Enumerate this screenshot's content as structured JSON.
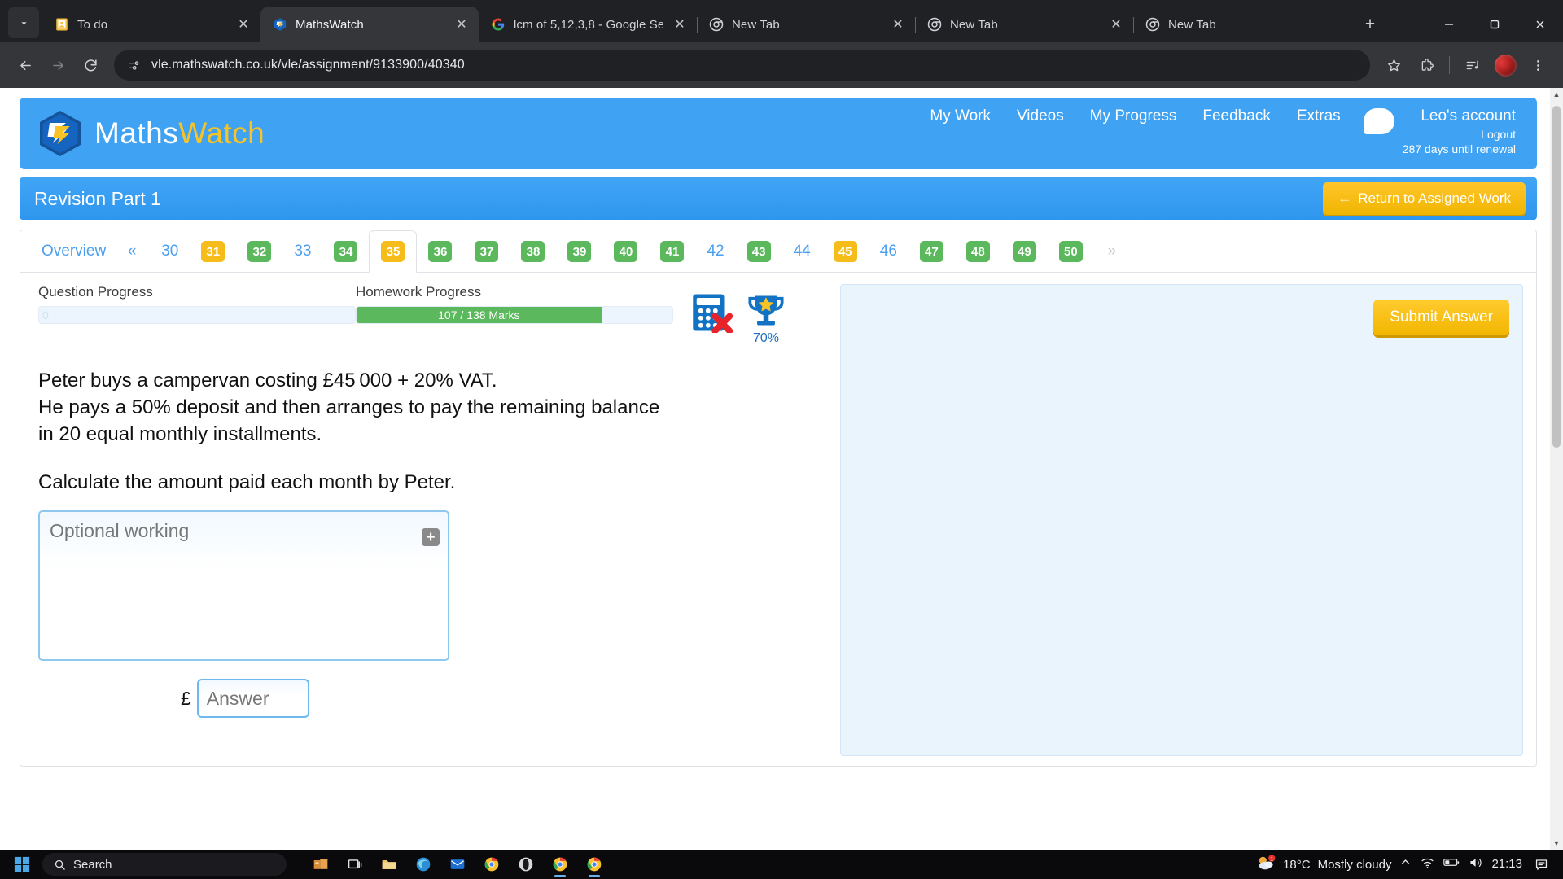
{
  "browser": {
    "tabs": [
      {
        "title": "To do",
        "favicon": "todo-icon",
        "active": false
      },
      {
        "title": "MathsWatch",
        "favicon": "mathswatch-icon",
        "active": true
      },
      {
        "title": "lcm of 5,12,3,8 - Google Se",
        "favicon": "google-icon",
        "active": false
      },
      {
        "title": "New Tab",
        "favicon": "chrome-icon",
        "active": false
      },
      {
        "title": "New Tab",
        "favicon": "chrome-icon",
        "active": false
      },
      {
        "title": "New Tab",
        "favicon": "chrome-icon",
        "active": false
      }
    ],
    "new_tab_label": "+",
    "close_label": "✕",
    "url": "vle.mathswatch.co.uk/vle/assignment/9133900/40340",
    "toolbar_icons": [
      "bookmark-star-icon",
      "extensions-icon",
      "media-playlist-icon",
      "profile-avatar",
      "chrome-menu-icon"
    ]
  },
  "site": {
    "logo": {
      "maths": "Maths",
      "watch": "Watch"
    },
    "nav": [
      "My Work",
      "Videos",
      "My Progress",
      "Feedback",
      "Extras"
    ],
    "account": {
      "name": "Leo's account",
      "logout": "Logout",
      "renewal": "287 days until renewal"
    },
    "assignment_title": "Revision Part 1",
    "return_button": "Return to Assigned Work",
    "return_arrow": "←"
  },
  "question_tabs": {
    "overview_label": "Overview",
    "prev_label": "«",
    "next_label": "»",
    "items": [
      {
        "num": "30",
        "state": "plain"
      },
      {
        "num": "31",
        "state": "amber"
      },
      {
        "num": "32",
        "state": "green"
      },
      {
        "num": "33",
        "state": "plain"
      },
      {
        "num": "34",
        "state": "green"
      },
      {
        "num": "35",
        "state": "amber",
        "active": true
      },
      {
        "num": "36",
        "state": "green"
      },
      {
        "num": "37",
        "state": "green"
      },
      {
        "num": "38",
        "state": "green"
      },
      {
        "num": "39",
        "state": "green"
      },
      {
        "num": "40",
        "state": "green"
      },
      {
        "num": "41",
        "state": "green"
      },
      {
        "num": "42",
        "state": "plain"
      },
      {
        "num": "43",
        "state": "green"
      },
      {
        "num": "44",
        "state": "plain"
      },
      {
        "num": "45",
        "state": "amber"
      },
      {
        "num": "46",
        "state": "plain"
      },
      {
        "num": "47",
        "state": "green"
      },
      {
        "num": "48",
        "state": "green"
      },
      {
        "num": "49",
        "state": "green"
      },
      {
        "num": "50",
        "state": "green"
      }
    ]
  },
  "progress": {
    "question": {
      "label": "Question Progress",
      "value_text": "0",
      "percent": 0
    },
    "homework": {
      "label": "Homework Progress",
      "value_text": "107 / 138 Marks",
      "percent": 77.5
    },
    "calculator": {
      "name": "calculator-not-allowed-icon"
    },
    "trophy": {
      "name": "trophy-icon",
      "percent_label": "70%"
    }
  },
  "question": {
    "line1": "Peter buys a campervan costing £45 000 + 20% VAT.",
    "line2": "He pays a 50% deposit and then arranges to pay the remaining balance",
    "line3": "in 20 equal monthly installments.",
    "line4": "Calculate the amount paid each month by Peter.",
    "working_placeholder": "Optional working",
    "working_value": "",
    "expand_label": "+",
    "answer_prefix": "£",
    "answer_placeholder": "Answer",
    "answer_value": "",
    "submit_label": "Submit Answer"
  },
  "colors": {
    "brand_blue": "#3fa2f2",
    "amber": "#f5bc1a",
    "green": "#5cb85c",
    "link_blue": "#4a9ff0",
    "submit_yellow": "#f2b600"
  },
  "taskbar": {
    "search_placeholder": "Search",
    "weather_temp": "18°C",
    "weather_desc": "Mostly cloudy",
    "clock_time": "21:13",
    "apps": [
      "file-explorer-icon",
      "task-view-icon",
      "folder-icon",
      "edge-icon",
      "mail-icon",
      "chrome-icon",
      "opera-icon",
      "chrome-icon-2",
      "chrome-icon-3"
    ],
    "sys_icons": [
      "chevron-up-icon",
      "wifi-icon",
      "battery-icon",
      "volume-icon"
    ],
    "notification_icon": "notification-icon"
  }
}
